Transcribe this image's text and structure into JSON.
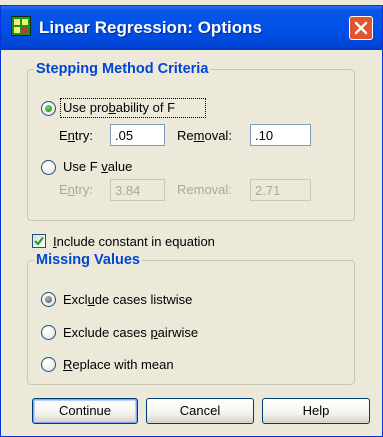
{
  "window": {
    "title": "Linear Regression: Options"
  },
  "stepping": {
    "title": "Stepping Method Criteria",
    "use_probability": {
      "label_pre": "Use pro",
      "label_acc": "b",
      "label_post": "ability of F",
      "selected": true
    },
    "prob_entry_label_pre": "E",
    "prob_entry_label_acc": "n",
    "prob_entry_label_post": "try:",
    "prob_entry_value": ".05",
    "prob_removal_label_pre": "Re",
    "prob_removal_label_acc": "m",
    "prob_removal_label_post": "oval:",
    "prob_removal_value": ".10",
    "use_f_value": {
      "label_pre": "Use F ",
      "label_acc": "v",
      "label_post": "alue",
      "selected": false
    },
    "f_entry_label_pre": "E",
    "f_entry_label_acc": "n",
    "f_entry_label_post": "try:",
    "f_entry_value": "3.84",
    "f_removal_label_pre": "Removal",
    "f_removal_label_acc": "",
    "f_removal_label_post": ":",
    "f_removal_value": "2.71"
  },
  "include_constant": {
    "label_pre": "",
    "label_acc": "I",
    "label_post": "nclude constant in equation",
    "checked": true
  },
  "missing": {
    "title": "Missing Values",
    "listwise": {
      "label_pre": "Excl",
      "label_acc": "u",
      "label_post": "de cases listwise",
      "selected": true
    },
    "pairwise": {
      "label_pre": "Exclude cases ",
      "label_acc": "p",
      "label_post": "airwise",
      "selected": false
    },
    "replace": {
      "label_pre": "",
      "label_acc": "R",
      "label_post": "eplace with mean",
      "selected": false
    }
  },
  "buttons": {
    "continue": "Continue",
    "cancel": "Cancel",
    "help": "Help"
  },
  "colors": {
    "titlebar": "#0050e8",
    "group_title": "#0046d5",
    "dialog_bg": "#ece9d8",
    "radio_selected": "#21a121",
    "check_mark": "#21a121",
    "close_button": "#e2552c"
  }
}
